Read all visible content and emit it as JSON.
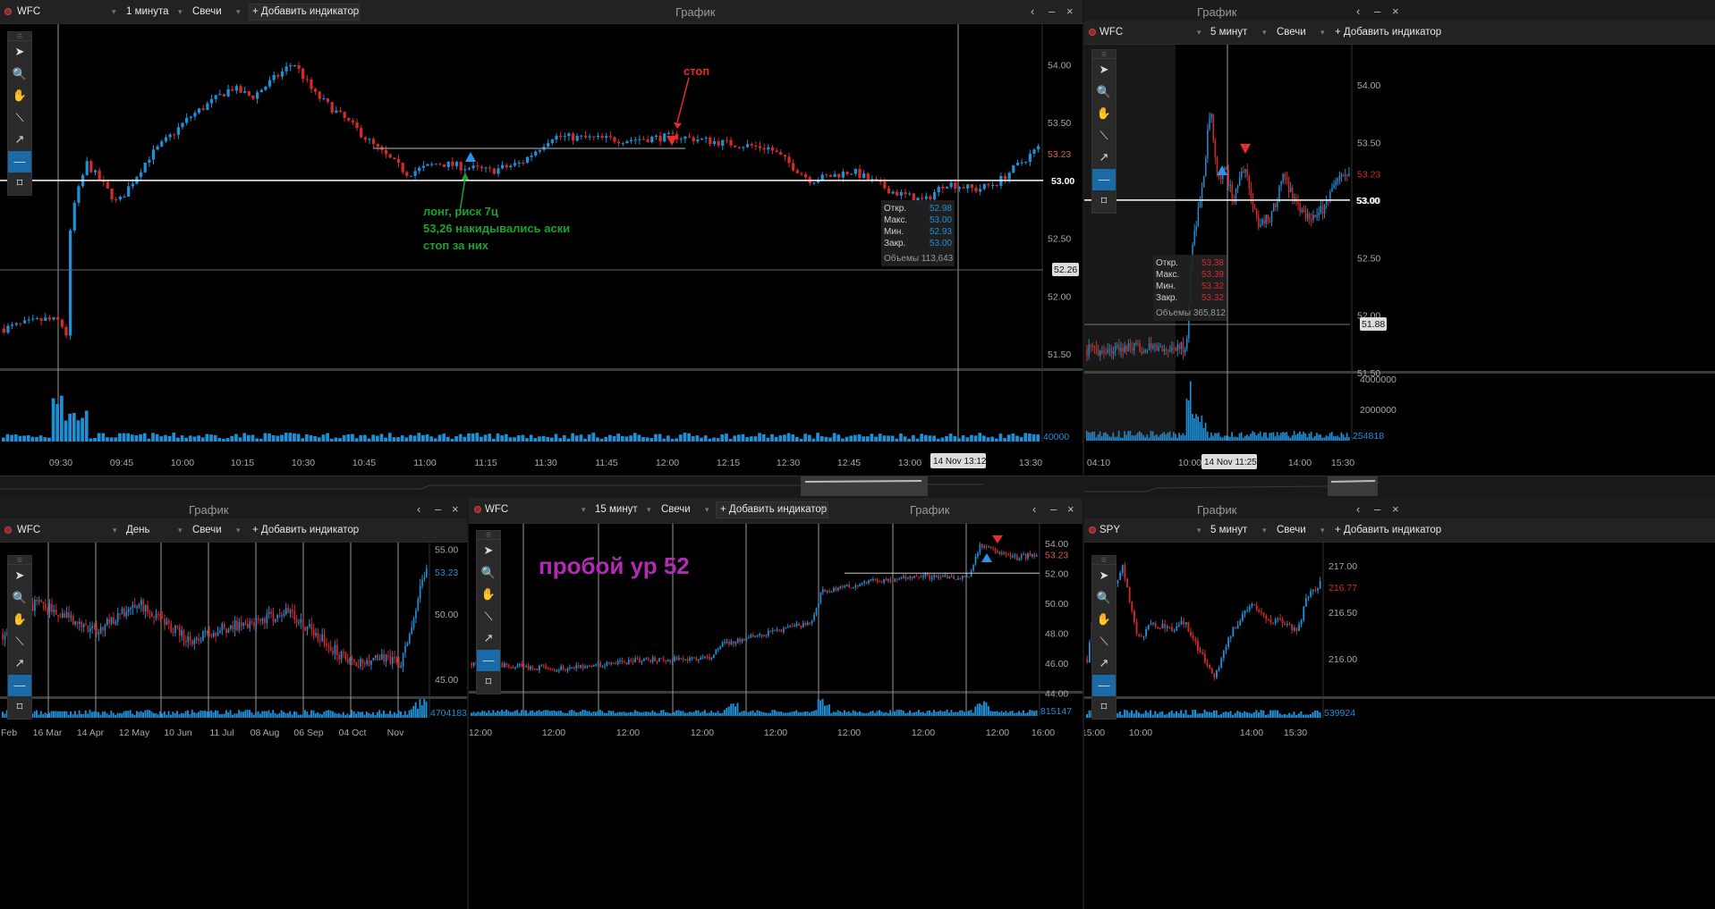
{
  "window_title": "График",
  "controls": {
    "back": "‹",
    "minimize": "–",
    "close": "×",
    "caret": "▾",
    "prev": "‹"
  },
  "tools": [
    {
      "icon": "cursor-icon",
      "glyph": "➤"
    },
    {
      "icon": "zoom-icon",
      "glyph": "🔍"
    },
    {
      "icon": "hand-icon",
      "glyph": "✋"
    },
    {
      "icon": "line-icon",
      "glyph": "⟍"
    },
    {
      "icon": "arrow-icon",
      "glyph": "↗"
    },
    {
      "icon": "hline-icon",
      "glyph": "—"
    },
    {
      "icon": "rect-icon",
      "glyph": "⌑"
    }
  ],
  "colors": {
    "up": "#1f8fd6",
    "down": "#d42a2a",
    "green_text": "#1aa32a",
    "red_text": "#e52d2d",
    "purple_text": "#b42ab4"
  },
  "panels": [
    {
      "id": "p1",
      "symbol": "WFC",
      "timeframe": "1 минута",
      "style": "Свечи",
      "add": "+ Добавить индикатор",
      "price_ticks": [
        "54.00",
        "53.50",
        "53.00",
        "52.50",
        "52.00",
        "51.50"
      ],
      "time_ticks": [
        "09:30",
        "09:45",
        "10:00",
        "10:15",
        "10:30",
        "10:45",
        "11:00",
        "11:15",
        "11:30",
        "11:45",
        "12:00",
        "12:15",
        "12:30",
        "12:45",
        "13:00",
        "13:30"
      ],
      "price_label": "53.23",
      "level_label": "53.00",
      "cursor_label": "52.26",
      "volume_label": "40000",
      "crosshair_time": "14 Nov 13:12",
      "ohlc": {
        "open_lbl": "Откр.",
        "open": "52.98",
        "high_lbl": "Макс.",
        "high": "53.00",
        "low_lbl": "Мин.",
        "low": "52.93",
        "close_lbl": "Закр.",
        "close": "53.00",
        "vol_lbl": "Объемы",
        "vol": "113,643"
      },
      "ann_stop": "стоп",
      "ann_long": [
        "лонг,    риск 7ц",
        "53,26 накидывались аски",
        "стоп за них"
      ]
    },
    {
      "id": "p2",
      "symbol": "WFC",
      "timeframe": "5 минут",
      "style": "Свечи",
      "add": "+ Добавить индикатор",
      "price_ticks": [
        "54.00",
        "53.50",
        "53.00",
        "52.50",
        "52.00",
        "51.50"
      ],
      "vol_ticks": [
        "4000000",
        "2000000"
      ],
      "time_ticks": [
        "04:10",
        "10:00",
        "14:00",
        "15:30"
      ],
      "price_label": "53.23",
      "level_label": "53.00",
      "cursor_label": "51.88",
      "volume_label": "254818",
      "crosshair_time": "14 Nov 11:25",
      "ohlc": {
        "open_lbl": "Откр.",
        "open": "53.38",
        "high_lbl": "Макс.",
        "high": "53.39",
        "low_lbl": "Мин.",
        "low": "53.32",
        "close_lbl": "Закр.",
        "close": "53.32",
        "vol_lbl": "Объемы",
        "vol": "365,812"
      }
    },
    {
      "id": "p3",
      "symbol": "WFC",
      "timeframe": "День",
      "style": "Свечи",
      "add": "+ Добавить индикатор",
      "price_ticks": [
        "55.00",
        "50.00",
        "45.00"
      ],
      "time_ticks": [
        "Feb",
        "16 Mar",
        "14 Apr",
        "12 May",
        "10 Jun",
        "11 Jul",
        "08 Aug",
        "06 Sep",
        "04 Oct",
        "Nov"
      ],
      "price_label": "53.23",
      "volume_label": "4704183"
    },
    {
      "id": "p4",
      "symbol": "WFC",
      "timeframe": "15 минут",
      "style": "Свечи",
      "add": "+ Добавить индикатор",
      "price_ticks": [
        "54.00",
        "52.00",
        "50.00",
        "48.00",
        "46.00",
        "44.00"
      ],
      "time_ticks": [
        "12:00",
        "12:00",
        "12:00",
        "12:00",
        "12:00",
        "12:00",
        "12:00",
        "12:00",
        "16:00"
      ],
      "price_label": "53.23",
      "volume_label": "815147",
      "ann_breakout": "пробой ур 52"
    },
    {
      "id": "p5",
      "symbol": "SPY",
      "timeframe": "5 минут",
      "style": "Свечи",
      "add": "+ Добавить индикатор",
      "price_ticks": [
        "217.00",
        "216.50",
        "216.00"
      ],
      "time_ticks": [
        "15:00",
        "10:00",
        "14:00",
        "15:30"
      ],
      "price_label": "216.77",
      "volume_label": "539924"
    }
  ],
  "chart_data": [
    {
      "type": "candlestick",
      "title": "WFC 1 минута",
      "ylim": [
        51.3,
        54.35
      ],
      "series": [
        {
          "name": "WFC",
          "path": [
            [
              0,
              51.72
            ],
            [
              0.04,
              51.8
            ],
            [
              0.055,
              51.78
            ],
            [
              0.06,
              51.62
            ],
            [
              0.065,
              52.7
            ],
            [
              0.08,
              53.15
            ],
            [
              0.11,
              52.8
            ],
            [
              0.14,
              53.2
            ],
            [
              0.18,
              53.55
            ],
            [
              0.22,
              53.8
            ],
            [
              0.24,
              53.72
            ],
            [
              0.28,
              54.02
            ],
            [
              0.3,
              53.75
            ],
            [
              0.34,
              53.45
            ],
            [
              0.36,
              53.28
            ],
            [
              0.39,
              53.06
            ],
            [
              0.42,
              53.15
            ],
            [
              0.47,
              53.08
            ],
            [
              0.5,
              53.15
            ],
            [
              0.53,
              53.38
            ],
            [
              0.6,
              53.35
            ],
            [
              0.65,
              53.38
            ],
            [
              0.7,
              53.32
            ],
            [
              0.74,
              53.28
            ],
            [
              0.78,
              53.0
            ],
            [
              0.82,
              53.08
            ],
            [
              0.86,
              52.9
            ],
            [
              0.89,
              52.82
            ],
            [
              0.91,
              52.98
            ],
            [
              0.94,
              52.92
            ],
            [
              0.96,
              52.98
            ],
            [
              1.0,
              53.28
            ]
          ]
        }
      ]
    },
    {
      "type": "candlestick",
      "title": "WFC 5 минут",
      "ylim": [
        51.4,
        54.35
      ],
      "series": [
        {
          "name": "WFC",
          "path": [
            [
              0,
              51.7
            ],
            [
              0.38,
              51.72
            ],
            [
              0.4,
              52.6
            ],
            [
              0.44,
              53.1
            ],
            [
              0.47,
              53.8
            ],
            [
              0.5,
              53.2
            ],
            [
              0.53,
              53.25
            ],
            [
              0.56,
              53.0
            ],
            [
              0.6,
              53.3
            ],
            [
              0.65,
              52.8
            ],
            [
              0.7,
              52.85
            ],
            [
              0.75,
              53.2
            ],
            [
              0.82,
              52.9
            ],
            [
              0.88,
              52.85
            ],
            [
              0.94,
              53.1
            ],
            [
              1.0,
              53.28
            ]
          ]
        }
      ]
    },
    {
      "type": "candlestick",
      "title": "WFC День",
      "ylim": [
        43.5,
        55.5
      ],
      "series": [
        {
          "name": "WFC",
          "path": [
            [
              0,
              48.5
            ],
            [
              0.08,
              50.8
            ],
            [
              0.15,
              49.8
            ],
            [
              0.22,
              48.6
            ],
            [
              0.32,
              50.9
            ],
            [
              0.38,
              49.5
            ],
            [
              0.44,
              48.0
            ],
            [
              0.52,
              48.9
            ],
            [
              0.6,
              49.5
            ],
            [
              0.67,
              50.2
            ],
            [
              0.72,
              49.0
            ],
            [
              0.78,
              47.3
            ],
            [
              0.83,
              46.0
            ],
            [
              0.9,
              46.8
            ],
            [
              0.94,
              46.2
            ],
            [
              0.97,
              50.0
            ],
            [
              1.0,
              53.8
            ]
          ]
        }
      ]
    },
    {
      "type": "candlestick",
      "title": "WFC 15 минут",
      "ylim": [
        43.6,
        55.3
      ],
      "series": [
        {
          "name": "WFC",
          "path": [
            [
              0,
              46.0
            ],
            [
              0.15,
              45.6
            ],
            [
              0.3,
              46.2
            ],
            [
              0.42,
              46.3
            ],
            [
              0.44,
              47.2
            ],
            [
              0.6,
              48.7
            ],
            [
              0.62,
              50.8
            ],
            [
              0.72,
              51.5
            ],
            [
              0.8,
              51.8
            ],
            [
              0.88,
              51.7
            ],
            [
              0.9,
              53.8
            ],
            [
              0.93,
              53.5
            ],
            [
              0.96,
              53.0
            ],
            [
              1.0,
              53.3
            ]
          ]
        }
      ]
    },
    {
      "type": "candlestick",
      "title": "SPY 5 минут",
      "ylim": [
        215.55,
        217.25
      ],
      "series": [
        {
          "name": "SPY",
          "path": [
            [
              0,
              216.0
            ],
            [
              0.05,
              216.9
            ],
            [
              0.1,
              216.6
            ],
            [
              0.15,
              217.0
            ],
            [
              0.22,
              216.2
            ],
            [
              0.28,
              216.4
            ],
            [
              0.35,
              216.3
            ],
            [
              0.42,
              216.4
            ],
            [
              0.5,
              216.0
            ],
            [
              0.55,
              215.8
            ],
            [
              0.62,
              216.3
            ],
            [
              0.7,
              216.6
            ],
            [
              0.78,
              216.4
            ],
            [
              0.84,
              216.4
            ],
            [
              0.9,
              216.3
            ],
            [
              0.95,
              216.7
            ],
            [
              1.0,
              216.8
            ]
          ]
        }
      ]
    }
  ]
}
